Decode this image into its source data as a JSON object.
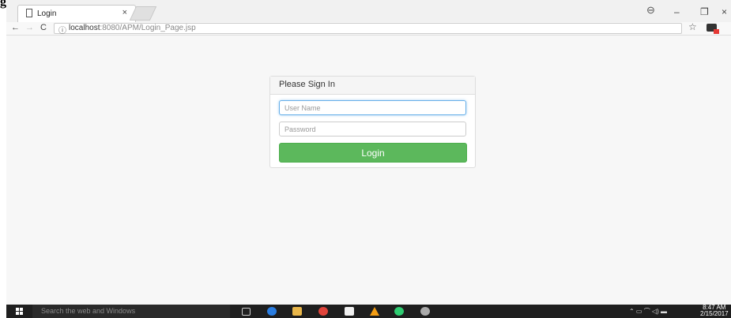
{
  "document": {
    "heading": "gin:"
  },
  "browser": {
    "tab_title": "Login",
    "tab_close": "×",
    "window_controls": {
      "account": "⊖",
      "minimize": "–",
      "restore": "❐",
      "close": "×"
    },
    "nav": {
      "back": "←",
      "forward": "→",
      "reload": "C"
    },
    "address": {
      "info_icon": "ⓘ",
      "host": "localhost",
      "rest": ":8080/APM/Login_Page.jsp"
    },
    "star": "☆",
    "menu": "⋮"
  },
  "login_panel": {
    "heading": "Please Sign In",
    "username_placeholder": "User Name",
    "password_placeholder": "Password",
    "submit_label": "Login"
  },
  "colors": {
    "button": "#5cb85c",
    "focus_border": "#66afe9",
    "taskbar": "#1f1f1f"
  },
  "taskbar": {
    "search_placeholder": "Search the web and Windows",
    "tray": "⌃  ▭  ⌒  ◁)  ▬",
    "time": "8:47 AM",
    "date": "2/15/2017"
  }
}
